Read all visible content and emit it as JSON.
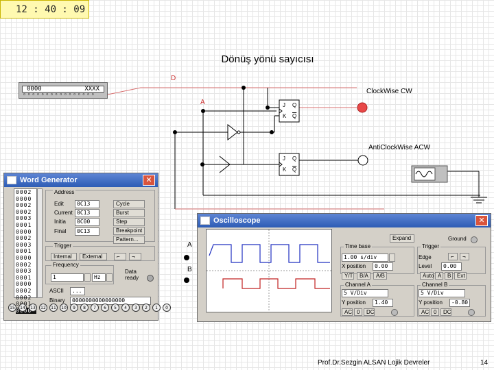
{
  "clock": "12 : 40 : 09",
  "slide_title": "Dönüş yönü sayıcısı",
  "circuit": {
    "label_d": "D",
    "label_a": "A",
    "cw_label": "ClockWise CW",
    "acw_label": "AntiClockWise ACW",
    "ff1": {
      "j": "J",
      "k": "K",
      "q": "Q",
      "qn": "Q"
    },
    "ff2": {
      "j": "J",
      "k": "K",
      "q": "Q",
      "qn": "Q"
    },
    "mini_wg": {
      "left": "0000",
      "right": "XXXX",
      "pins": "o o o o o o o o o o o o o o o o"
    },
    "colors": {
      "wire_red": "#d87070",
      "led_on": "#e84848"
    }
  },
  "word_generator": {
    "title": "Word Generator",
    "address_label": "Address",
    "edit_label": "Edit",
    "edit_value": "0C13",
    "current_label": "Current",
    "current_value": "0C13",
    "initial_label": "Initia",
    "initial_value": "0C00",
    "final_label": "Final",
    "final_value": "0C13",
    "buttons": [
      "Cycle",
      "Burst",
      "Step",
      "Breakpoint",
      "Pattern..."
    ],
    "trigger_label": "Trigger",
    "internal": "Internal",
    "external": "External",
    "frequency_label": "Frequency",
    "freq_value": "1",
    "freq_unit": "Hz",
    "data_ready": "Data ready",
    "ascii_label": "ASCII",
    "ascii_value": "...",
    "binary_label": "Binary",
    "binary_value": "0000000000000000",
    "address_rows": [
      "0002",
      "0000",
      "0002",
      "0002",
      "0003",
      "0001",
      "0000",
      "0002",
      "0003",
      "0001",
      "0000",
      "0002",
      "0003",
      "0001",
      "0000",
      "0002",
      "0002",
      "0001",
      "0000"
    ],
    "selected_row": 18,
    "pins": [
      "15",
      "14",
      "13",
      "12",
      "11",
      "10",
      "9",
      "8",
      "7",
      "6",
      "5",
      "4",
      "3",
      "2",
      "1",
      "0"
    ]
  },
  "oscilloscope": {
    "title": "Oscilloscope",
    "expand": "Expand",
    "ground": "Ground",
    "time_base": "Time base",
    "time_value": "1.00 s/div",
    "xpos_label": "X position",
    "xpos_value": "0.00",
    "modes": [
      "Y/T",
      "B/A",
      "A/B"
    ],
    "channel_a": "Channel A",
    "cha_value": "5 V/Div",
    "cha_ypos_label": "Y position",
    "cha_ypos_value": "1.40",
    "coupling": [
      "AC",
      "0",
      "DC"
    ],
    "trigger": "Trigger",
    "edge": "Edge",
    "level": "Level",
    "level_value": "0.00",
    "trig_modes": [
      "Auto",
      "A",
      "B",
      "Ext"
    ],
    "channel_b": "Channel B",
    "chb_value": "5 V/Div",
    "chb_ypos_label": "Y position",
    "chb_ypos_value": "-0.80",
    "input_a": "A",
    "input_b": "B"
  },
  "footer": {
    "text": "Prof.Dr.Sezgin ALSAN  Lojik Devreler",
    "page": "14"
  }
}
